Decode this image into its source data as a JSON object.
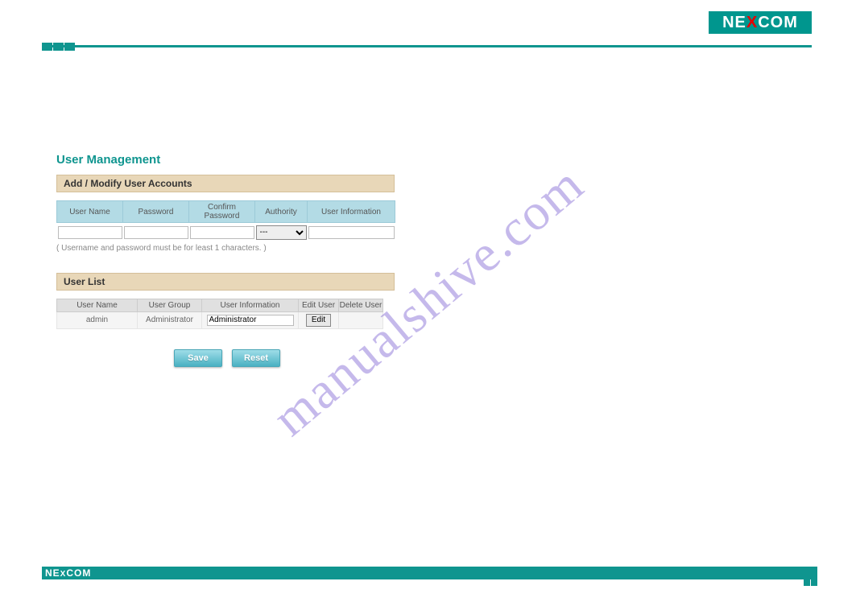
{
  "brand": "NEXCOM",
  "page_title": "User Management",
  "watermark": "manualshive.com",
  "sections": {
    "add_modify": "Add / Modify User Accounts",
    "user_list": "User List"
  },
  "add_form": {
    "headers": {
      "username": "User Name",
      "password": "Password",
      "confirm": "Confirm Password",
      "authority": "Authority",
      "userinfo": "User Information"
    },
    "values": {
      "username": "",
      "password": "",
      "confirm": "",
      "authority": "---",
      "userinfo": ""
    },
    "hint": "( Username and password must be for least 1 characters. )"
  },
  "user_list": {
    "headers": {
      "username": "User Name",
      "group": "User Group",
      "info": "User Information",
      "edit": "Edit User",
      "delete": "Delete User"
    },
    "rows": [
      {
        "username": "admin",
        "group": "Administrator",
        "info": "Administrator",
        "edit_label": "Edit"
      }
    ]
  },
  "buttons": {
    "save": "Save",
    "reset": "Reset"
  }
}
